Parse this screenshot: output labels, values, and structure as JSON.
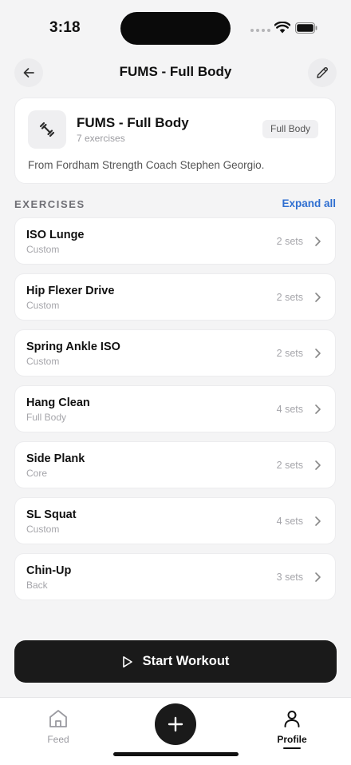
{
  "status_bar": {
    "time": "3:18"
  },
  "header": {
    "title": "FUMS - Full Body"
  },
  "routine": {
    "title": "FUMS - Full Body",
    "subtitle": "7 exercises",
    "badge": "Full Body",
    "description": "From Fordham Strength Coach Stephen Georgio."
  },
  "section": {
    "label": "EXERCISES",
    "expand_label": "Expand all"
  },
  "exercises": [
    {
      "name": "ISO Lunge",
      "category": "Custom",
      "sets": "2 sets"
    },
    {
      "name": "Hip Flexer Drive",
      "category": "Custom",
      "sets": "2 sets"
    },
    {
      "name": "Spring Ankle ISO",
      "category": "Custom",
      "sets": "2 sets"
    },
    {
      "name": "Hang Clean",
      "category": "Full Body",
      "sets": "4 sets"
    },
    {
      "name": "Side Plank",
      "category": "Core",
      "sets": "2 sets"
    },
    {
      "name": "SL Squat",
      "category": "Custom",
      "sets": "4 sets"
    },
    {
      "name": "Chin-Up",
      "category": "Back",
      "sets": "3 sets"
    }
  ],
  "start_button": {
    "label": "Start Workout"
  },
  "tab_bar": {
    "feed_label": "Feed",
    "profile_label": "Profile",
    "active": "Profile"
  },
  "icons": {
    "back": "arrow-left-icon",
    "edit": "pencil-icon",
    "routine": "dumbbell-icon",
    "chevron": "chevron-right-icon",
    "play": "play-icon",
    "feed": "home-icon",
    "add": "plus-icon",
    "profile": "person-icon"
  },
  "colors": {
    "accent": "#2f6fd1",
    "primary_button": "#1a1a1a",
    "background": "#f4f4f5"
  }
}
